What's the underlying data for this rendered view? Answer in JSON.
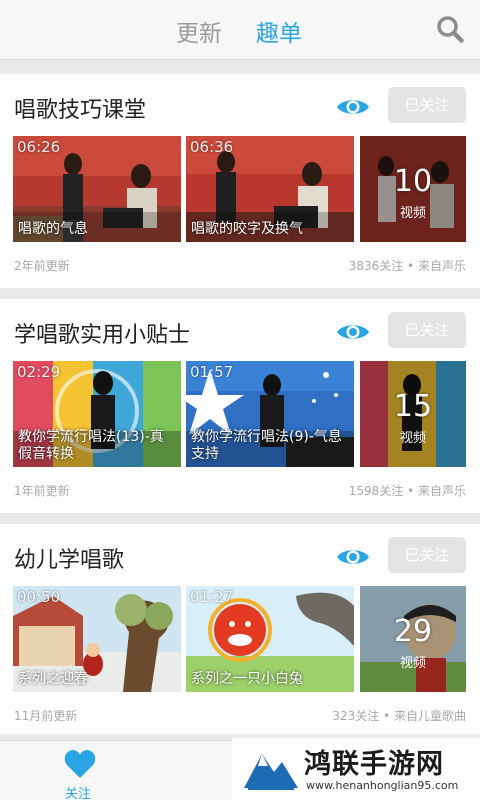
{
  "header": {
    "tab_update": "更新",
    "tab_fun": "趣单",
    "search_icon": "search-icon"
  },
  "colors": {
    "accent": "#2aa4e3",
    "follow_button": "#e4e4e4"
  },
  "cards": [
    {
      "title": "唱歌技巧课堂",
      "follow_label": "已关注",
      "videos": [
        {
          "duration": "06:26",
          "title": "唱歌的气息"
        },
        {
          "duration": "06:36",
          "title": "唱歌的咬字及换气"
        }
      ],
      "count": "10",
      "count_label": "视频",
      "updated": "2年前更新",
      "stats": "3836关注 • 来自声乐"
    },
    {
      "title": "学唱歌实用小贴士",
      "follow_label": "已关注",
      "videos": [
        {
          "duration": "02:29",
          "title": "教你学流行唱法(13)-真假音转换"
        },
        {
          "duration": "01:57",
          "title": "教你学流行唱法(9)-气息支持"
        }
      ],
      "count": "15",
      "count_label": "视频",
      "updated": "1年前更新",
      "stats": "1598关注 • 来自声乐"
    },
    {
      "title": "幼儿学唱歌",
      "follow_label": "已关注",
      "videos": [
        {
          "duration": "00:50",
          "title": "系列之迎春"
        },
        {
          "duration": "01:27",
          "title": "系列之一只小白兔"
        }
      ],
      "count": "29",
      "count_label": "视频",
      "updated": "11月前更新",
      "stats": "323关注 • 来自儿童歌曲"
    }
  ],
  "bottom_nav": {
    "follow_label": "关注"
  },
  "watermark": {
    "title": "鸿联手游网",
    "url": "www.henanhonglian95.com"
  }
}
